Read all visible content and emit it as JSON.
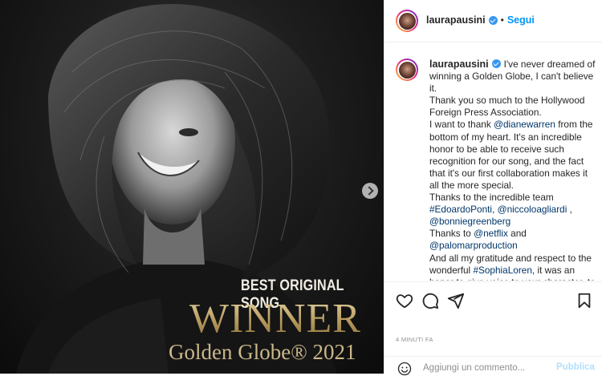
{
  "post": {
    "username": "laurapausini",
    "follow_label": "Segui",
    "dot": "•",
    "caption": {
      "p1": "I've never dreamed of winning a Golden Globe, I can't believe it.",
      "p2": "Thank you so much to the Hollywood Foreign Press Association.",
      "p3_before": "I want to thank ",
      "mention_dianewarren": "@dianewarren",
      "p3_after": " from the bottom of my heart. It's an incredible honor to be able to receive such recognition for our song, and the fact that it's our first collaboration makes it all the more special.",
      "p4": "Thanks to the incredible team",
      "tag_edoardo": "#EdoardoPonti",
      "sep_comma": ", ",
      "mention_niccolo": "@niccoloagliardi",
      "comma_after": " ,",
      "mention_bonnie": "@bonniegreenberg",
      "p6_before": "Thanks to ",
      "mention_netflix": "@netflix",
      "p6_after": " and",
      "mention_palomar": "@palomarproduction",
      "p7_before": "And all my gratitude and respect to the wonderful ",
      "tag_sophia": "#SophiaLoren",
      "p7_after": ", it was an honor to give voice to your character, to convey such an important"
    },
    "timestamp": "4 MINUTI FA",
    "comment_placeholder": "Aggiungi un commento...",
    "publish_label": "Pubblica"
  },
  "poster": {
    "line1": "BEST ORIGINAL SONG",
    "line2": "WINNER",
    "line3": "Golden Globe® 2021"
  },
  "icons": {
    "verified": "verified-badge-icon",
    "like": "heart-icon",
    "comment": "comment-icon",
    "share": "paper-plane-icon",
    "save": "bookmark-icon",
    "emoji": "emoji-icon",
    "next": "chevron-right-icon"
  },
  "colors": {
    "follow": "#0095f6",
    "link": "#00376b",
    "publish_disabled": "#b2dffc",
    "muted": "#8e8e8e",
    "gold": "#c9b27e"
  }
}
